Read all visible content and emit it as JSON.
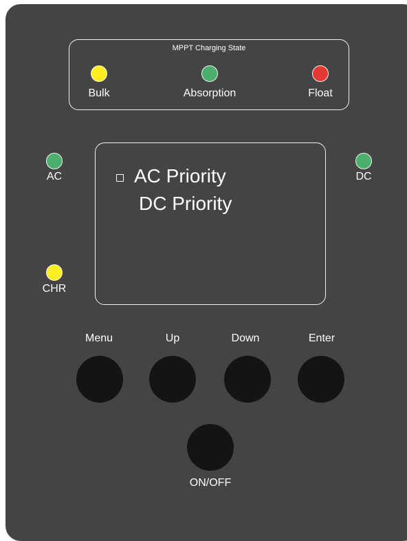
{
  "mppt": {
    "title": "MPPT Charging State",
    "indicators": [
      {
        "label": "Bulk",
        "color": "#ffee22"
      },
      {
        "label": "Absorption",
        "color": "#4caf6e"
      },
      {
        "label": "Float",
        "color": "#e53935"
      }
    ]
  },
  "status": {
    "ac": {
      "label": "AC",
      "color": "#4caf6e"
    },
    "dc": {
      "label": "DC",
      "color": "#4caf6e"
    },
    "chr": {
      "label": "CHR",
      "color": "#ffee22"
    }
  },
  "display": {
    "options": [
      "AC Priority",
      "DC Priority"
    ],
    "selected_index": 0
  },
  "buttons": {
    "menu": "Menu",
    "up": "Up",
    "down": "Down",
    "enter": "Enter",
    "power": "ON/OFF"
  },
  "colors": {
    "panel": "#444444",
    "button": "#141414",
    "border": "#f2f2f2"
  }
}
